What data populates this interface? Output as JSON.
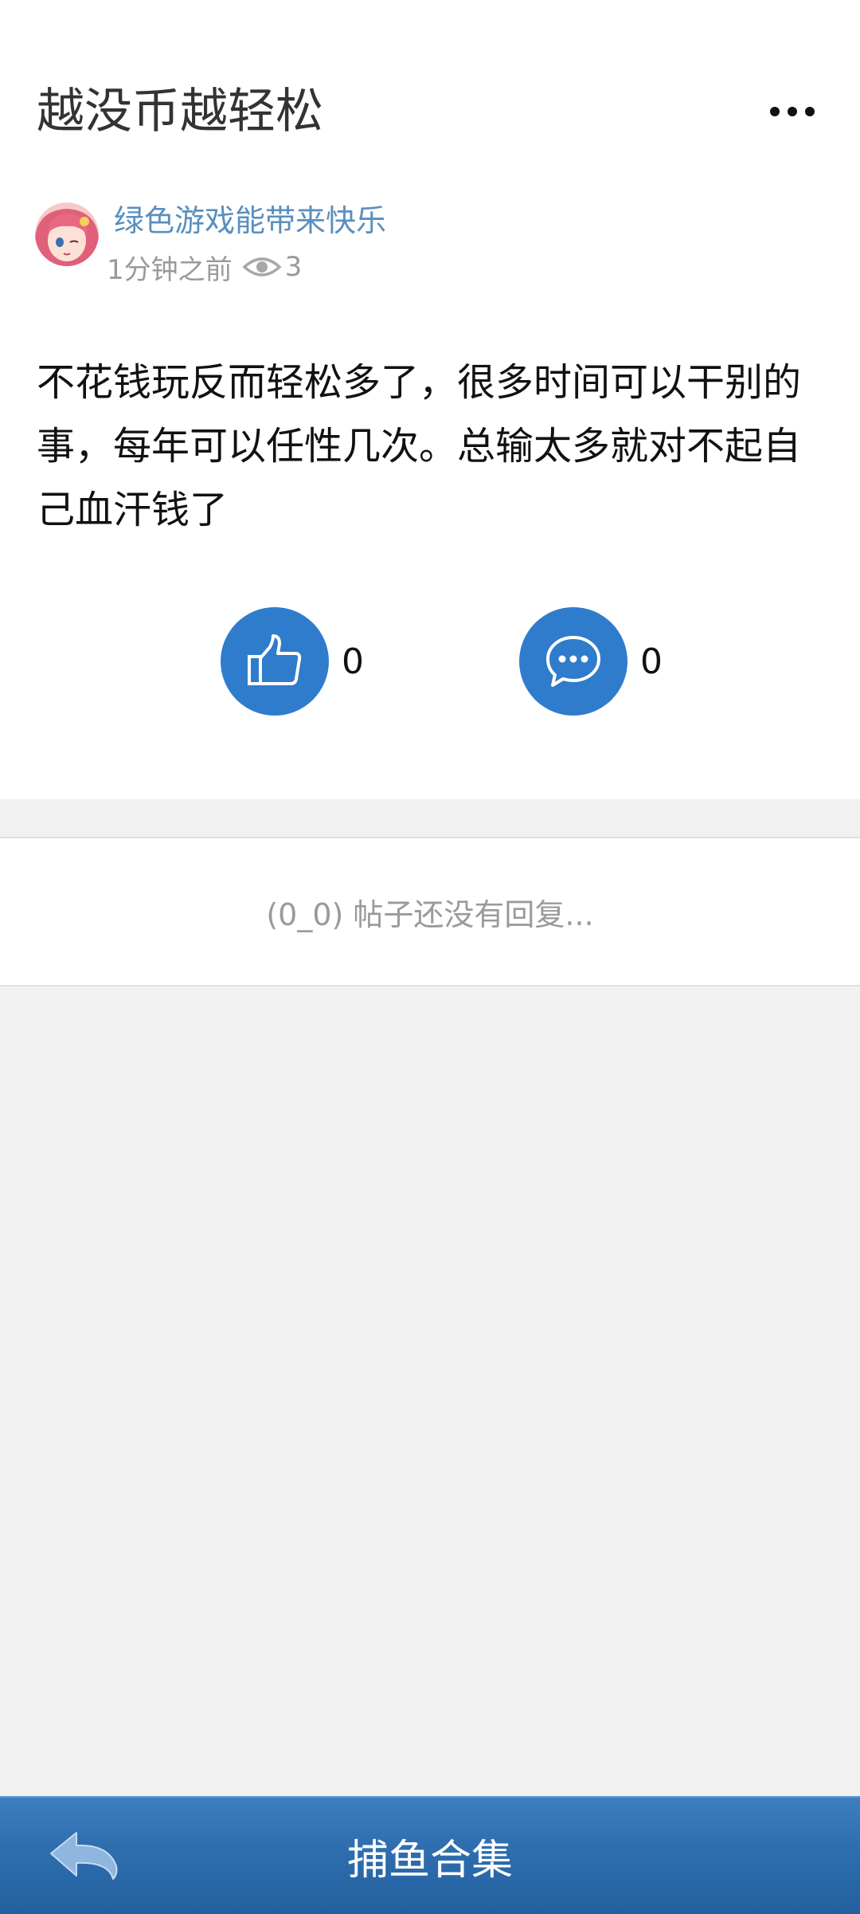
{
  "post": {
    "title": "越没币越轻松",
    "author": "绿色游戏能带来快乐",
    "time": "1分钟之前",
    "views": "3",
    "content": "不花钱玩反而轻松多了，很多时间可以干别的事，每年可以任性几次。总输太多就对不起自己血汗钱了",
    "likes": "0",
    "comments": "0"
  },
  "replies": {
    "empty_text": "(0_0) 帖子还没有回复..."
  },
  "bottom_bar": {
    "title": "捕鱼合集"
  },
  "colors": {
    "accent": "#2f7ccc",
    "author": "#5a8fbf",
    "bar": "#2f6fb0"
  },
  "icons": [
    "more-icon",
    "eye-icon",
    "thumbs-up-icon",
    "comment-icon",
    "back-arrow-icon"
  ]
}
